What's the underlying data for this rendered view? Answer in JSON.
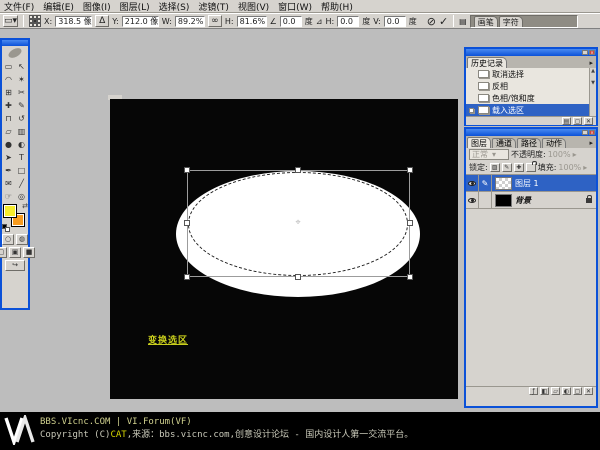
{
  "menu": {
    "items": [
      {
        "label": "文件(F)"
      },
      {
        "label": "编辑(E)"
      },
      {
        "label": "图像(I)"
      },
      {
        "label": "图层(L)"
      },
      {
        "label": "选择(S)"
      },
      {
        "label": "滤镜(T)"
      },
      {
        "label": "视图(V)"
      },
      {
        "label": "窗口(W)"
      },
      {
        "label": "帮助(H)"
      }
    ]
  },
  "options_bar": {
    "tool_preset_glyph": "▭",
    "tool_preset_arrow": "▾",
    "x_label": "X:",
    "x_value": "318.5 像",
    "delta_glyph": "Δ",
    "y_label": "Y:",
    "y_value": "212.0 像",
    "w_label": "W:",
    "w_value": "89.2%",
    "link_glyph": "∞",
    "h_label": "H:",
    "h_value": "81.6%",
    "angle_glyph": "∠",
    "angle_value": "0.0",
    "deg_label": "度",
    "skew_glyph": "⊿",
    "skew_h_label": "H:",
    "skew_h_value": "0.0",
    "skew_v_label": "V:",
    "skew_v_value": "0.0",
    "cancel_glyph": "⊘",
    "commit_glyph": "✓",
    "brushes_toggle_glyph": "▤",
    "well_tabs": [
      {
        "label": "画笔"
      },
      {
        "label": "字符"
      }
    ]
  },
  "toolbox": {
    "foreground_color": "#f6ec2c",
    "background_color": "#f79b1e",
    "swap_glyph": "⇄",
    "tools": [
      {
        "name": "rectangular-marquee",
        "glyph": "▭"
      },
      {
        "name": "move",
        "glyph": "↖"
      },
      {
        "name": "lasso",
        "glyph": "◠"
      },
      {
        "name": "magic-wand",
        "glyph": "✶"
      },
      {
        "name": "crop",
        "glyph": "⊞"
      },
      {
        "name": "slice",
        "glyph": "✂"
      },
      {
        "name": "healing-brush",
        "glyph": "✚"
      },
      {
        "name": "brush",
        "glyph": "✎"
      },
      {
        "name": "clone-stamp",
        "glyph": "⊓"
      },
      {
        "name": "history-brush",
        "glyph": "↺"
      },
      {
        "name": "eraser",
        "glyph": "▱"
      },
      {
        "name": "gradient",
        "glyph": "▥"
      },
      {
        "name": "blur",
        "glyph": "●"
      },
      {
        "name": "dodge",
        "glyph": "◐"
      },
      {
        "name": "path-selection",
        "glyph": "➤"
      },
      {
        "name": "type",
        "glyph": "T"
      },
      {
        "name": "pen",
        "glyph": "✒"
      },
      {
        "name": "shape",
        "glyph": "□"
      },
      {
        "name": "notes",
        "glyph": "✉"
      },
      {
        "name": "eyedropper",
        "glyph": "╱"
      },
      {
        "name": "hand",
        "glyph": "☞"
      },
      {
        "name": "zoom",
        "glyph": "◎"
      }
    ],
    "mode_buttons": [
      {
        "glyph": "○"
      },
      {
        "glyph": "◍"
      }
    ],
    "screen_buttons": [
      {
        "glyph": "▢"
      },
      {
        "glyph": "▣"
      },
      {
        "glyph": "■"
      }
    ],
    "jump_glyph": "↪"
  },
  "canvas": {
    "annotation": "变换选区"
  },
  "history_panel": {
    "title": "历史记录",
    "menu_glyph": "▸",
    "items": [
      {
        "label": "取消选择",
        "selected": false
      },
      {
        "label": "反相",
        "selected": false
      },
      {
        "label": "色相/饱和度",
        "selected": false
      },
      {
        "label": "载入选区",
        "selected": true
      }
    ],
    "foot_buttons": [
      {
        "glyph": "▤"
      },
      {
        "glyph": "◻"
      },
      {
        "glyph": "✕"
      }
    ],
    "scroll_up": "▲",
    "scroll_down": "▼"
  },
  "layers_panel": {
    "tabs": [
      {
        "label": "图层"
      },
      {
        "label": "通道"
      },
      {
        "label": "路径"
      },
      {
        "label": "动作"
      }
    ],
    "menu_glyph": "▸",
    "blend_mode": "正常",
    "blend_arrow": "▾",
    "opacity_label": "不透明度:",
    "opacity_value": "100%",
    "spin_arrow": "▸",
    "lock_label": "锁定:",
    "lock_glyphs": [
      {
        "glyph": "▨"
      },
      {
        "glyph": "✎"
      },
      {
        "glyph": "✚"
      }
    ],
    "fill_label": "填充:",
    "fill_value": "100%",
    "layers": [
      {
        "name": "图层 1"
      },
      {
        "name": "背景"
      }
    ],
    "foot_buttons": [
      {
        "glyph": "ƒ"
      },
      {
        "glyph": "◧"
      },
      {
        "glyph": "▱"
      },
      {
        "glyph": "◐"
      },
      {
        "glyph": "▢"
      },
      {
        "glyph": "✕"
      }
    ]
  },
  "footer": {
    "line1": "BBS.VIcnc.COM | VI.Forum(VF)",
    "line2_prefix": "Copyright (C)",
    "line2_cat": "CAT",
    "line2_rest": ",来源：bbs.vicnc.com,创意设计论坛 - 国内设计人第一交流平台。"
  }
}
